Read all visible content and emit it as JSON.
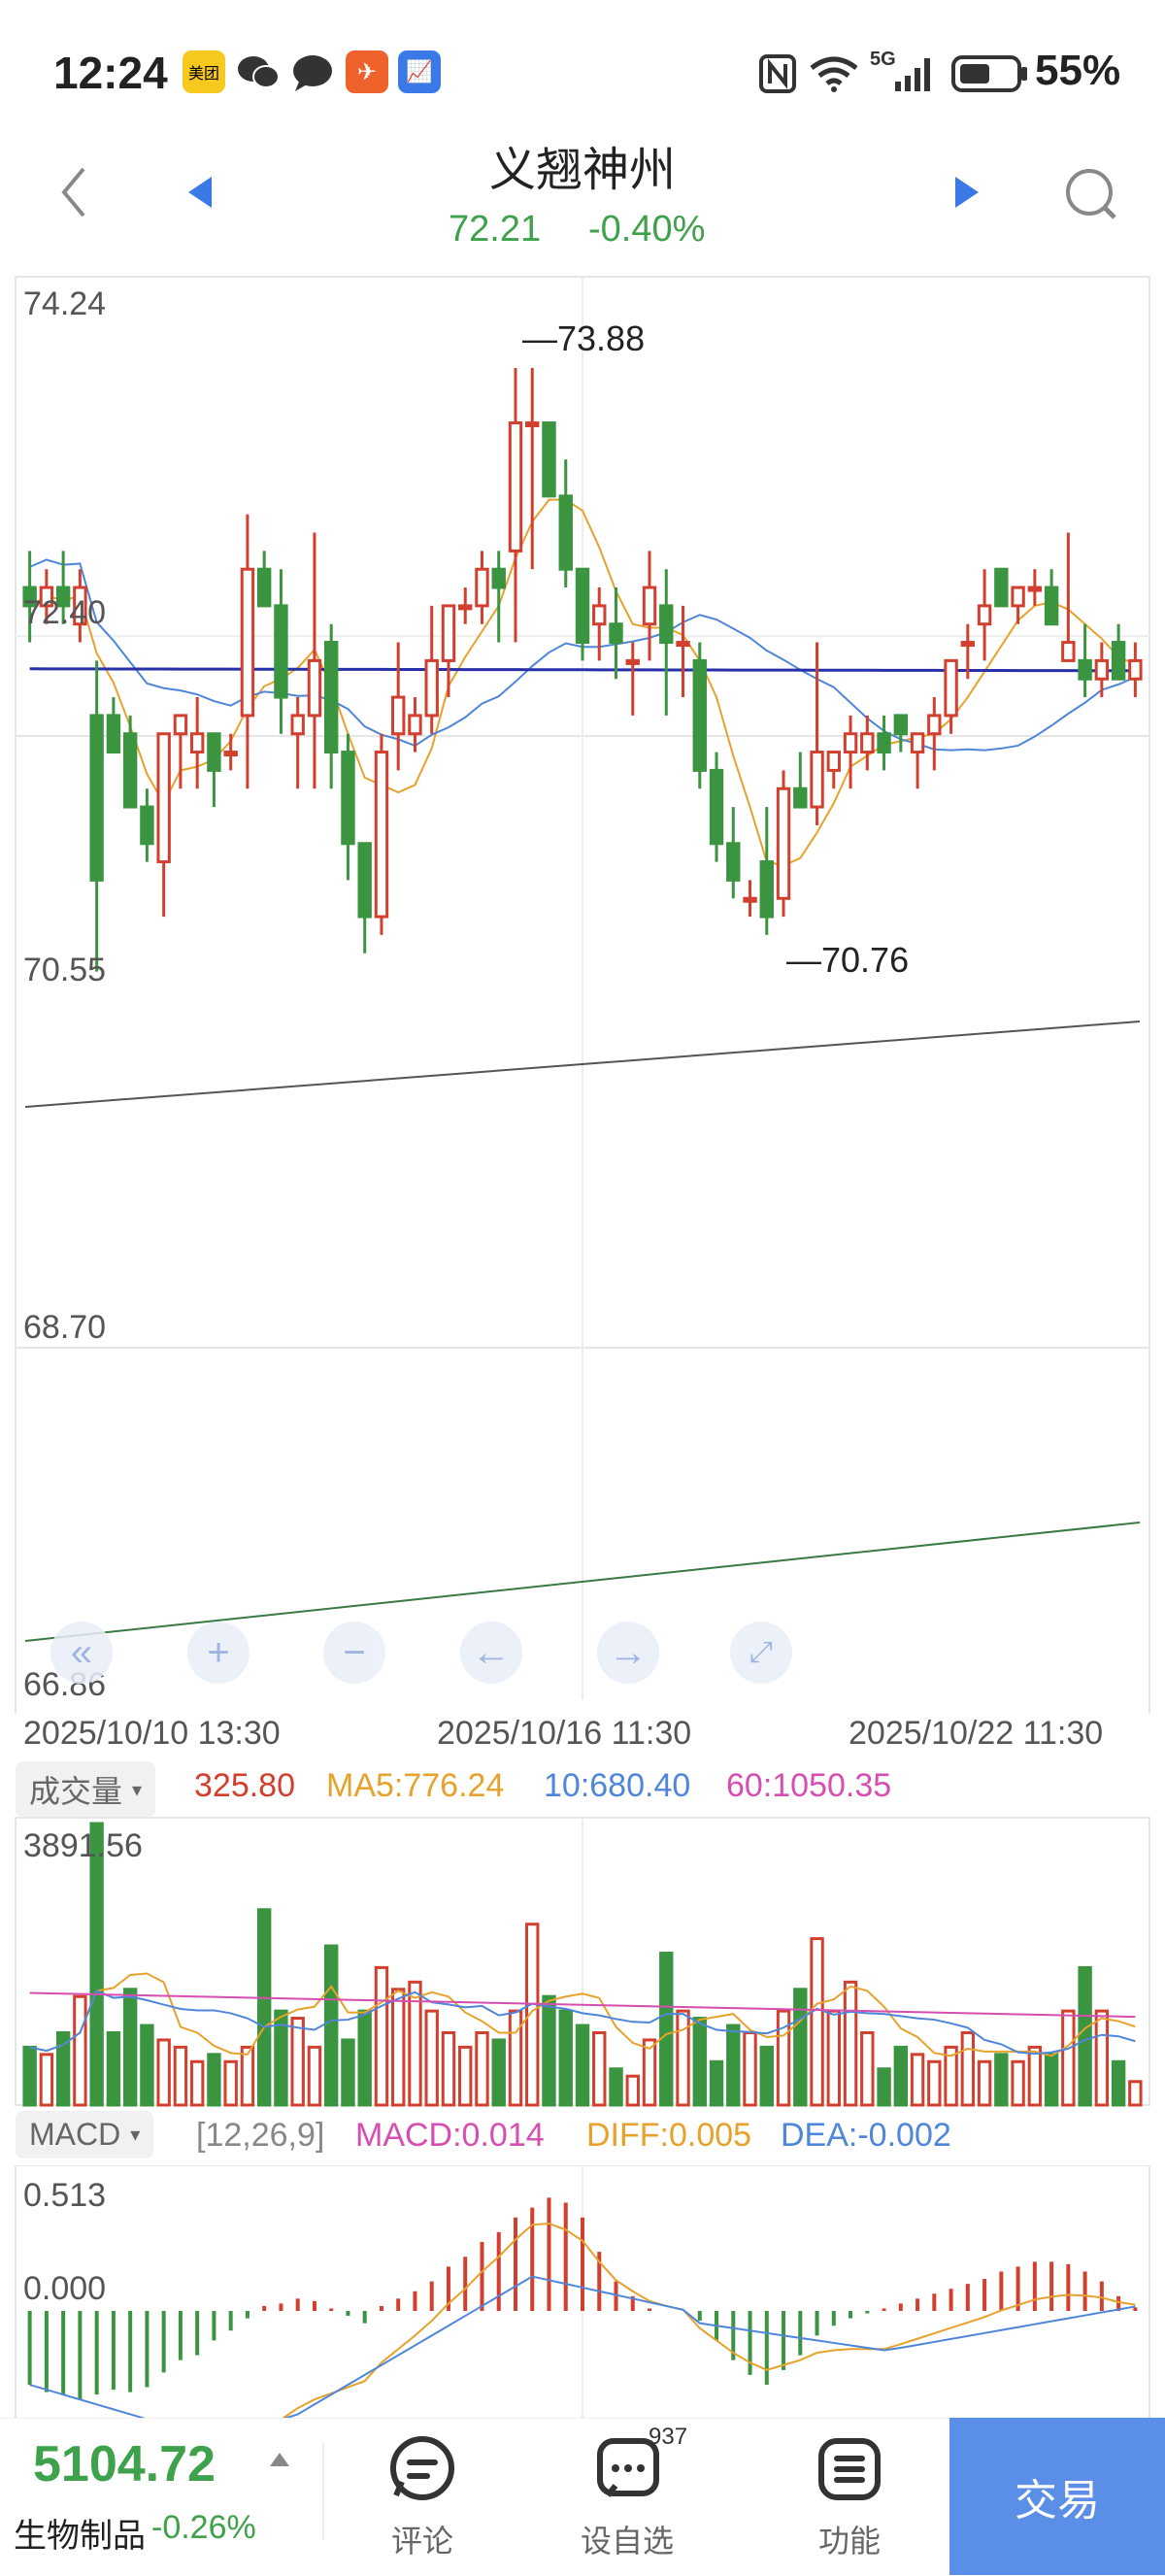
{
  "status_bar": {
    "time": "12:24",
    "apps": [
      {
        "icon": "meituan-icon",
        "label": "美团",
        "color": "#f7c81e"
      },
      {
        "icon": "wechat-icon",
        "label": "",
        "color": "#333333"
      },
      {
        "icon": "message-icon",
        "label": "",
        "color": "#333333"
      },
      {
        "icon": "feishu-icon",
        "label": "",
        "color": "#f0622b"
      },
      {
        "icon": "stock-app-icon",
        "label": "",
        "color": "#3b7ae6"
      }
    ],
    "network": "5G",
    "battery": "55%"
  },
  "header": {
    "title": "义翘神州",
    "price": "72.21",
    "change": "-0.40%",
    "price_color": "#3ea14b"
  },
  "main_chart": {
    "price_labels": [
      "74.24",
      "72.40",
      "70.55",
      "68.70",
      "66.86"
    ],
    "high_label": "73.88",
    "low_label": "70.76",
    "dates": [
      "2025/10/10 13:30",
      "2025/10/16 11:30",
      "2025/10/22 11:30"
    ],
    "controls": [
      "rewind-icon",
      "zoom-in-icon",
      "zoom-out-icon",
      "left-arrow-icon",
      "right-arrow-icon",
      "fullscreen-icon"
    ]
  },
  "volume": {
    "selector": "成交量",
    "value": "325.80",
    "ma5": "MA5:776.24",
    "ma10": "10:680.40",
    "ma60": "60:1050.35",
    "max_label": "3891.56"
  },
  "macd": {
    "selector": "MACD",
    "params": "[12,26,9]",
    "macd": "MACD:0.014",
    "diff": "DIFF:0.005",
    "dea": "DEA:-0.002",
    "top_label": "0.513",
    "zero_label": "0.000"
  },
  "bottom_bar": {
    "index_value": "5104.72",
    "index_name": "生物制品",
    "index_change": "-0.26%",
    "comment_label": "评论",
    "watchlist_label": "设自选",
    "watchlist_badge": "937",
    "functions_label": "功能",
    "trade_label": "交易"
  },
  "chart_data": {
    "type": "candlestick",
    "ylim": [
      66.86,
      74.24
    ],
    "high": 73.88,
    "low": 70.76,
    "candles": [
      [
        72.7,
        72.9,
        72.4,
        72.6
      ],
      [
        72.6,
        72.8,
        72.5,
        72.7
      ],
      [
        72.7,
        72.9,
        72.5,
        72.6
      ],
      [
        72.5,
        72.8,
        72.4,
        72.7
      ],
      [
        72.0,
        72.3,
        70.6,
        71.1
      ],
      [
        72.0,
        72.1,
        71.8,
        71.8
      ],
      [
        71.9,
        72.0,
        71.5,
        71.5
      ],
      [
        71.5,
        71.6,
        71.2,
        71.3
      ],
      [
        71.2,
        71.9,
        70.9,
        71.9
      ],
      [
        71.9,
        72.0,
        71.6,
        72.0
      ],
      [
        71.8,
        72.1,
        71.6,
        71.9
      ],
      [
        71.9,
        71.9,
        71.5,
        71.7
      ],
      [
        71.8,
        71.9,
        71.7,
        71.8
      ],
      [
        72.0,
        73.1,
        71.6,
        72.8
      ],
      [
        72.8,
        72.9,
        72.6,
        72.6
      ],
      [
        72.6,
        72.8,
        71.9,
        72.1
      ],
      [
        71.9,
        72.1,
        71.6,
        72.0
      ],
      [
        72.0,
        73.0,
        71.6,
        72.3
      ],
      [
        72.4,
        72.5,
        71.6,
        71.8
      ],
      [
        71.8,
        71.9,
        71.1,
        71.3
      ],
      [
        71.3,
        71.3,
        70.7,
        70.9
      ],
      [
        70.9,
        71.9,
        70.8,
        71.8
      ],
      [
        71.9,
        72.4,
        71.7,
        72.1
      ],
      [
        71.9,
        72.1,
        71.8,
        72.0
      ],
      [
        72.0,
        72.6,
        71.9,
        72.3
      ],
      [
        72.3,
        72.6,
        72.1,
        72.6
      ],
      [
        72.6,
        72.7,
        72.5,
        72.6
      ],
      [
        72.6,
        72.9,
        72.5,
        72.8
      ],
      [
        72.8,
        72.9,
        72.4,
        72.7
      ],
      [
        72.9,
        73.9,
        72.4,
        73.6
      ],
      [
        73.6,
        73.9,
        72.8,
        73.6
      ],
      [
        73.6,
        73.6,
        73.2,
        73.2
      ],
      [
        73.2,
        73.4,
        72.7,
        72.8
      ],
      [
        72.8,
        72.8,
        72.3,
        72.4
      ],
      [
        72.5,
        72.7,
        72.3,
        72.6
      ],
      [
        72.5,
        72.7,
        72.2,
        72.4
      ],
      [
        72.3,
        72.4,
        72.0,
        72.3
      ],
      [
        72.5,
        72.9,
        72.3,
        72.7
      ],
      [
        72.6,
        72.8,
        72.0,
        72.4
      ],
      [
        72.4,
        72.6,
        72.1,
        72.4
      ],
      [
        72.3,
        72.4,
        71.6,
        71.7
      ],
      [
        71.7,
        71.8,
        71.2,
        71.3
      ],
      [
        71.3,
        71.5,
        71.0,
        71.1
      ],
      [
        71.0,
        71.1,
        70.9,
        71.0
      ],
      [
        71.2,
        71.5,
        70.8,
        70.9
      ],
      [
        71.0,
        71.7,
        70.9,
        71.6
      ],
      [
        71.6,
        71.8,
        71.5,
        71.5
      ],
      [
        71.5,
        72.4,
        71.4,
        71.8
      ],
      [
        71.7,
        71.8,
        71.6,
        71.8
      ],
      [
        71.8,
        72.0,
        71.6,
        71.9
      ],
      [
        71.8,
        72.0,
        71.7,
        71.9
      ],
      [
        71.9,
        72.0,
        71.7,
        71.8
      ],
      [
        72.0,
        72.0,
        71.8,
        71.9
      ],
      [
        71.8,
        71.9,
        71.6,
        71.9
      ],
      [
        71.9,
        72.1,
        71.7,
        72.0
      ],
      [
        72.0,
        72.3,
        71.9,
        72.3
      ],
      [
        72.4,
        72.5,
        72.2,
        72.4
      ],
      [
        72.5,
        72.8,
        72.3,
        72.6
      ],
      [
        72.8,
        72.8,
        72.6,
        72.6
      ],
      [
        72.6,
        72.7,
        72.5,
        72.7
      ],
      [
        72.7,
        72.8,
        72.6,
        72.7
      ],
      [
        72.7,
        72.8,
        72.5,
        72.5
      ],
      [
        72.3,
        73.0,
        72.3,
        72.4
      ],
      [
        72.3,
        72.5,
        72.1,
        72.2
      ],
      [
        72.2,
        72.4,
        72.1,
        72.3
      ],
      [
        72.4,
        72.5,
        72.2,
        72.2
      ],
      [
        72.2,
        72.4,
        72.1,
        72.3
      ]
    ],
    "volume": [
      800,
      700,
      1000,
      1500,
      3891,
      1000,
      1600,
      1100,
      900,
      800,
      600,
      700,
      600,
      800,
      2700,
      1300,
      1200,
      800,
      2200,
      900,
      1300,
      1900,
      1600,
      1700,
      1300,
      1000,
      800,
      1000,
      900,
      1300,
      2500,
      1500,
      1300,
      1100,
      1000,
      500,
      400,
      900,
      2100,
      1300,
      1200,
      600,
      1100,
      1000,
      800,
      1300,
      1600,
      2300,
      1300,
      1700,
      1000,
      500,
      800,
      700,
      600,
      800,
      1000,
      600,
      700,
      600,
      800,
      700,
      1300,
      1900,
      1300,
      600,
      325
    ],
    "macd_hist": [
      -0.3,
      -0.33,
      -0.34,
      -0.36,
      -0.34,
      -0.32,
      -0.33,
      -0.31,
      -0.25,
      -0.2,
      -0.18,
      -0.12,
      -0.08,
      -0.03,
      0.02,
      0.03,
      0.05,
      0.04,
      0.01,
      -0.02,
      -0.05,
      0.02,
      0.05,
      0.08,
      0.12,
      0.18,
      0.22,
      0.28,
      0.32,
      0.38,
      0.42,
      0.46,
      0.44,
      0.38,
      0.24,
      0.12,
      0.06,
      0.01,
      0.0,
      0.0,
      -0.04,
      -0.12,
      -0.2,
      -0.26,
      -0.3,
      -0.24,
      -0.18,
      -0.1,
      -0.06,
      -0.03,
      -0.01,
      0.01,
      0.03,
      0.05,
      0.07,
      0.09,
      0.11,
      0.13,
      0.16,
      0.18,
      0.2,
      0.2,
      0.19,
      0.16,
      0.12,
      0.06,
      0.014
    ]
  }
}
